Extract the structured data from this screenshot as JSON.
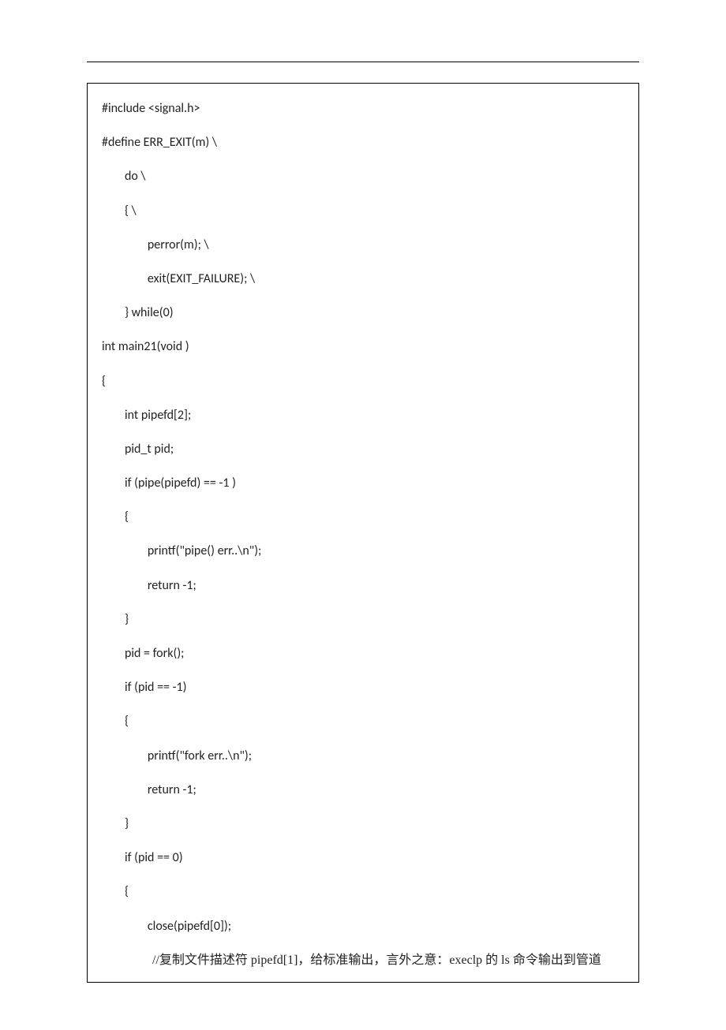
{
  "code": {
    "lines": [
      "#include <signal.h>",
      "",
      "",
      "#define ERR_EXIT(m) \\",
      "        do \\",
      "        { \\",
      "                perror(m); \\",
      "                exit(EXIT_FAILURE); \\",
      "        } while(0)",
      "",
      "",
      "int main21(void )",
      "{",
      "        int pipefd[2];",
      "        pid_t pid;",
      "        if (pipe(pipefd) == -1 )",
      "        {",
      "                printf(\"pipe() err..\\n\");  ",
      "                return -1;",
      "        }",
      "        pid = fork();",
      "        if (pid == -1)",
      "        {",
      "                printf(\"fork err..\\n\");",
      "                return -1;",
      "        }",
      "        if (pid == 0)",
      "        {",
      "                close(pipefd[0]);",
      "                //复制文件描述符 pipefd[1]，给标准输出，言外之意：execlp 的 ls 命令输出到管道"
    ]
  }
}
